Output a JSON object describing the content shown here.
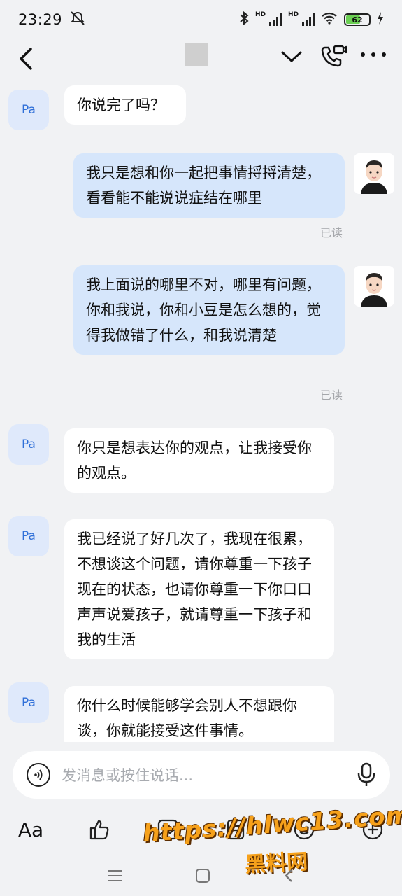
{
  "status": {
    "time": "23:29",
    "hd1": "HD",
    "hd2": "HD",
    "battery": "62"
  },
  "header": {
    "title": ""
  },
  "messages": [
    {
      "side": "in",
      "avatar": "Pa",
      "text": "你说完了吗？"
    },
    {
      "side": "out",
      "text": "我只是想和你一起把事情捋捋清楚，看看能不能说说症结在哪里",
      "receipt": "已读"
    },
    {
      "side": "out",
      "text": "我上面说的哪里不对，哪里有问题，你和我说，你和小豆是怎么想的，觉得我做错了什么，和我说清楚",
      "receipt": "已读"
    },
    {
      "side": "in",
      "avatar": "Pa",
      "text": "你只是想表达你的观点，让我接受你的观点。"
    },
    {
      "side": "in",
      "avatar": "Pa",
      "text": "我已经说了好几次了，我现在很累，不想谈这个问题，请你尊重一下孩子现在的状态，也请你尊重一下你口口声声说爱孩子，就请尊重一下孩子和我的生活"
    },
    {
      "side": "in",
      "avatar": "Pa",
      "text": "你什么时候能够学会别人不想跟你谈，你就能接受这件事情。"
    }
  ],
  "input": {
    "placeholder": "发消息或按住说话..."
  },
  "toolbar": {
    "font_label": "Aa"
  },
  "watermark": {
    "url": "https://hlwc13.com",
    "name": "黑料网"
  },
  "colors": {
    "outgoing_bubble": "#d6e6fb",
    "incoming_bubble": "#ffffff",
    "avatar_bg": "#dfe9fb",
    "avatar_text": "#2f6fd8"
  }
}
